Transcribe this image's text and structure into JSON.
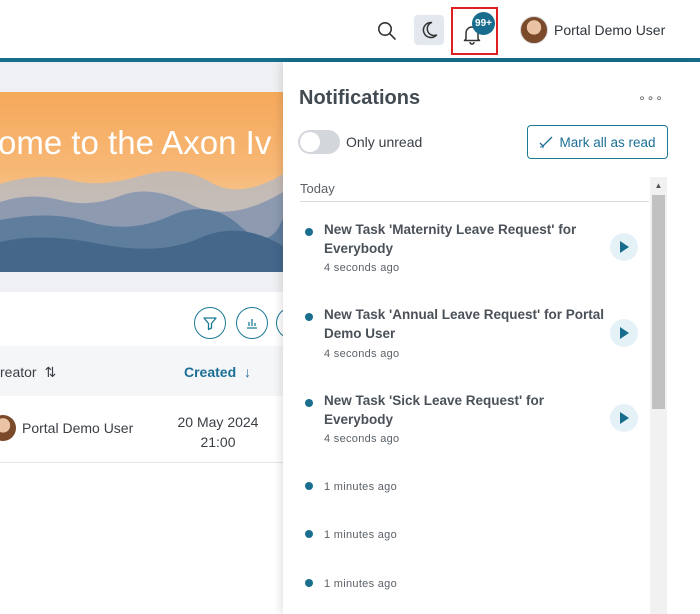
{
  "header": {
    "user_name": "Portal Demo User",
    "notification_badge": "99+",
    "icons": [
      "search-icon",
      "moon-icon",
      "bell-icon"
    ],
    "accent_color": "#166e8b"
  },
  "background": {
    "banner_title": "ome to the Axon Iv",
    "columns": {
      "creator": "reator",
      "created": "Created"
    },
    "row": {
      "creator": "Portal Demo User",
      "date": "20 May 2024",
      "time": "21:00"
    }
  },
  "panel": {
    "title": "Notifications",
    "toggle_label": "Only unread",
    "toggle_on": false,
    "mark_all_label": "Mark all as read",
    "section_today": "Today",
    "items": [
      {
        "title": "New Task 'Maternity Leave Request' for Everybody",
        "time": "4 seconds ago",
        "has_action": true
      },
      {
        "title": "New Task 'Annual Leave Request' for Portal Demo User",
        "time": "4 seconds ago",
        "has_action": true
      },
      {
        "title": "New Task 'Sick Leave Request' for Everybody",
        "time": "4 seconds ago",
        "has_action": true
      },
      {
        "title": "",
        "time": "1 minutes ago",
        "has_action": false
      },
      {
        "title": "",
        "time": "1 minutes ago",
        "has_action": false
      },
      {
        "title": "",
        "time": "1 minutes ago",
        "has_action": false
      }
    ]
  }
}
